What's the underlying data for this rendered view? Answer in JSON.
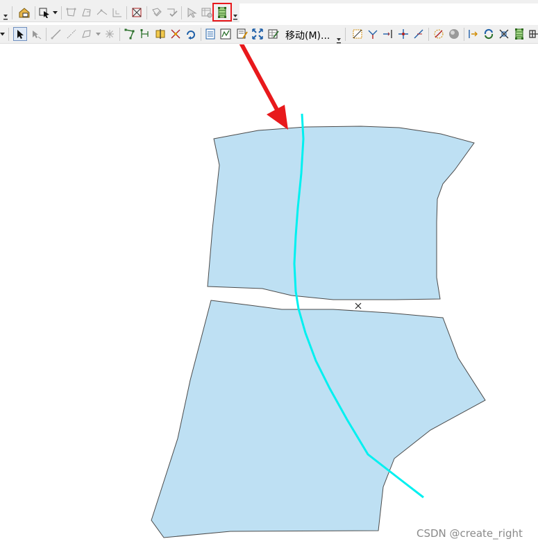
{
  "toolbar": {
    "move_label": "移动(M)...",
    "move_dropdown_arrow": "chevron-down-icon",
    "highlighted_tool": "topology-edit-tool-icon",
    "highlight_color": "#e8191c"
  },
  "map": {
    "polygon_fill": "#bee0f3",
    "polygon_stroke": "#4a4a4a",
    "line_color": "#00f0f0",
    "arrow_color": "#e8191c"
  },
  "watermark": "CSDN @create_right"
}
